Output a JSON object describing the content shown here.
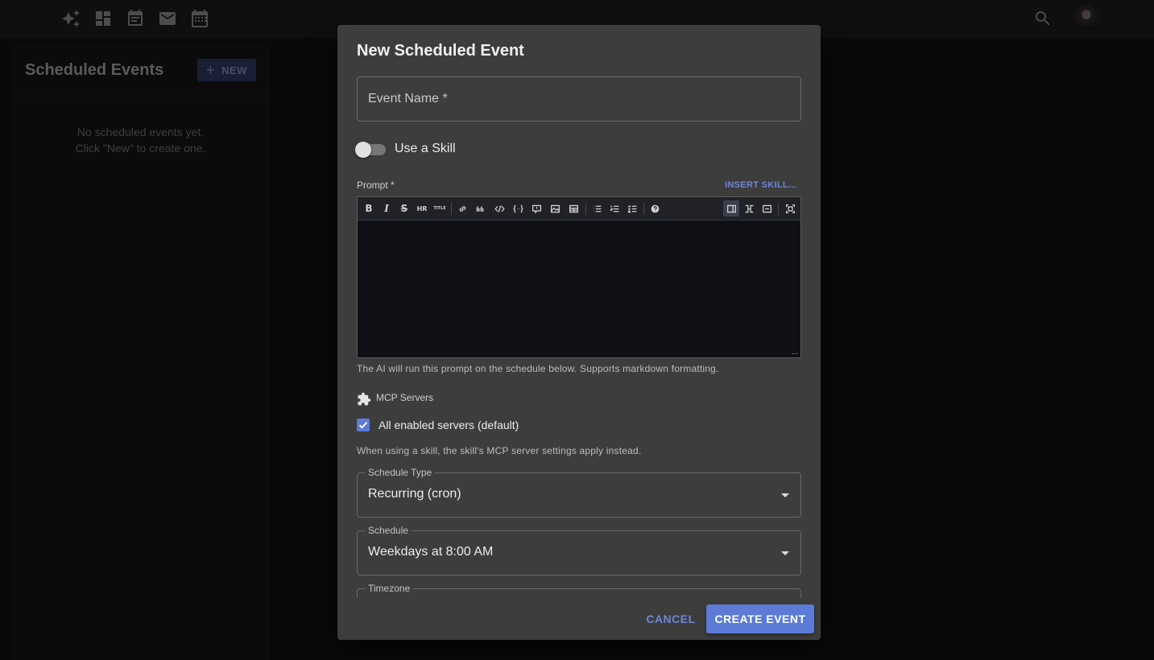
{
  "topbar": {
    "icons": [
      "sparkle-icon",
      "dashboard-icon",
      "event-note-icon",
      "mail-icon",
      "calendar-icon",
      "search-icon"
    ]
  },
  "sidebar": {
    "title": "Scheduled Events",
    "new_button": {
      "icon": "+",
      "label": "NEW"
    },
    "empty_line1": "No scheduled events yet.",
    "empty_line2": "Click \"New\" to create one."
  },
  "dialog": {
    "title": "New Scheduled Event",
    "event_name_placeholder": "Event Name *",
    "use_skill_label": "Use a Skill",
    "use_skill_on": false,
    "prompt_label": "Prompt *",
    "insert_skill": "INSERT SKILL...",
    "toolbar": {
      "bold": "B",
      "italic": "I",
      "strike": "S",
      "hr": "HR",
      "title": "TITLE"
    },
    "editor_resize": "...",
    "prompt_helper": "The AI will run this prompt on the schedule below. Supports markdown formatting.",
    "mcp_label": "MCP Servers",
    "all_servers_label": "All enabled servers (default)",
    "all_servers_checked": true,
    "mcp_helper": "When using a skill, the skill's MCP server settings apply instead.",
    "schedule_type": {
      "label": "Schedule Type",
      "value": "Recurring (cron)"
    },
    "schedule": {
      "label": "Schedule",
      "value": "Weekdays at 8:00 AM"
    },
    "timezone": {
      "label": "Timezone"
    },
    "cancel": "CANCEL",
    "create": "CREATE EVENT"
  },
  "colors": {
    "accent": "#5b7bd6",
    "dialog_bg": "#3d3d3d",
    "editor_bg": "#0e1016"
  }
}
